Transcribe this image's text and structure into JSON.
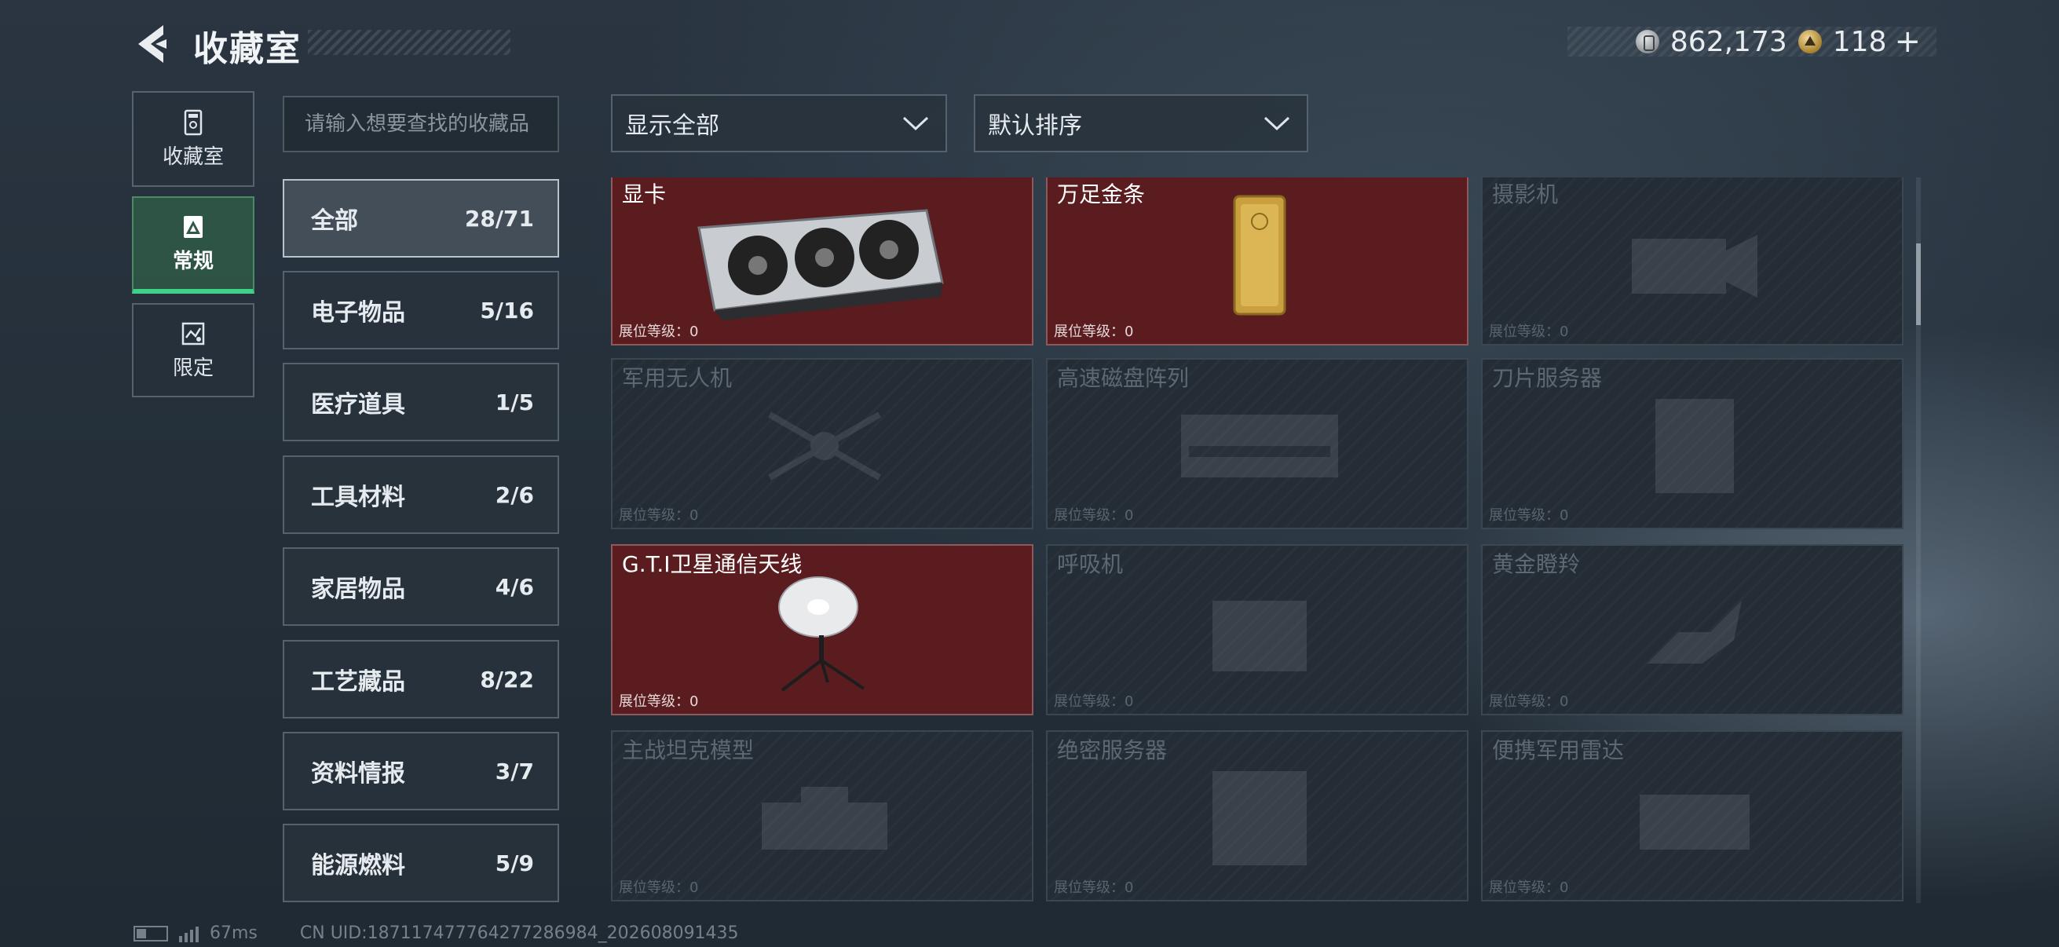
{
  "header": {
    "title": "收藏室",
    "currency": [
      {
        "icon": "silver-coin-icon",
        "value": "862,173"
      },
      {
        "icon": "gold-coin-icon",
        "value": "118"
      }
    ],
    "plus_label": "+"
  },
  "nav": [
    {
      "label": "收藏室",
      "icon": "collection-room-icon",
      "active": false
    },
    {
      "label": "常规",
      "icon": "regular-icon",
      "active": true
    },
    {
      "label": "限定",
      "icon": "limited-icon",
      "active": false
    }
  ],
  "search": {
    "placeholder": "请输入想要查找的收藏品"
  },
  "categories": [
    {
      "label": "全部",
      "count": "28/71",
      "active": true
    },
    {
      "label": "电子物品",
      "count": "5/16"
    },
    {
      "label": "医疗道具",
      "count": "1/5"
    },
    {
      "label": "工具材料",
      "count": "2/6"
    },
    {
      "label": "家居物品",
      "count": "4/6"
    },
    {
      "label": "工艺藏品",
      "count": "8/22"
    },
    {
      "label": "资料情报",
      "count": "3/7"
    },
    {
      "label": "能源燃料",
      "count": "5/9"
    }
  ],
  "filters": {
    "show": "显示全部",
    "sort": "默认排序"
  },
  "items": [
    {
      "name": "显卡",
      "level": "展位等级：0",
      "owned": true
    },
    {
      "name": "万足金条",
      "level": "展位等级：0",
      "owned": true
    },
    {
      "name": "摄影机",
      "level": "展位等级：0",
      "owned": false
    },
    {
      "name": "军用无人机",
      "level": "展位等级：0",
      "owned": false
    },
    {
      "name": "高速磁盘阵列",
      "level": "展位等级：0",
      "owned": false
    },
    {
      "name": "刀片服务器",
      "level": "展位等级：0",
      "owned": false
    },
    {
      "name": "G.T.I卫星通信天线",
      "level": "展位等级：0",
      "owned": true
    },
    {
      "name": "呼吸机",
      "level": "展位等级：0",
      "owned": false
    },
    {
      "name": "黄金瞪羚",
      "level": "展位等级：0",
      "owned": false
    },
    {
      "name": "主战坦克模型",
      "level": "展位等级：0",
      "owned": false
    },
    {
      "name": "绝密服务器",
      "level": "展位等级：0",
      "owned": false
    },
    {
      "name": "便携军用雷达",
      "level": "展位等级：0",
      "owned": false
    }
  ],
  "footer": {
    "ping": "67ms",
    "uid": "CN UID:18711747776427728698​4_202608091435"
  }
}
